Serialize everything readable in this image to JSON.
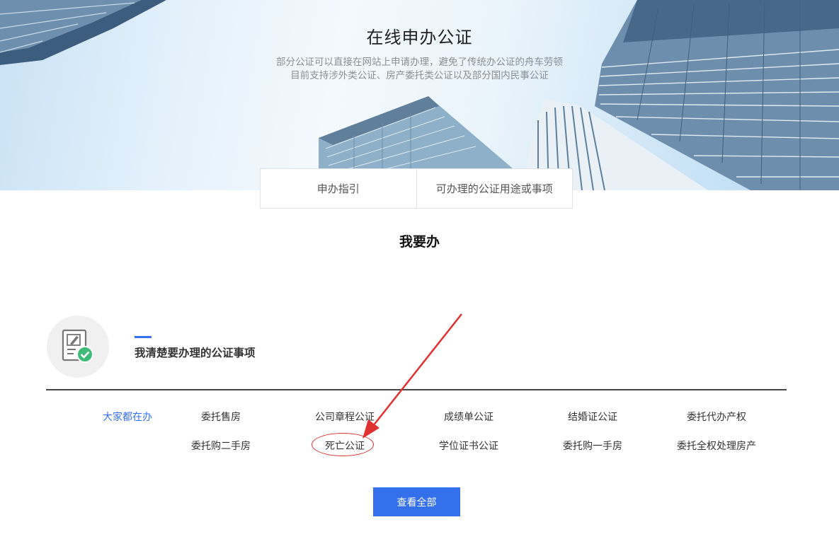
{
  "hero": {
    "title": "在线申办公证",
    "subtitle_line1": "部分公证可以直接在网站上申请办理，避免了传统办公证的舟车劳顿",
    "subtitle_line2": "目前支持涉外类公证、房产委托类公证以及部分国内民事公证"
  },
  "tabs": [
    "申办指引",
    "可办理的公证用途或事项"
  ],
  "section": {
    "title": "我要办",
    "category_title": "我清楚要办理的公证事项",
    "popular_label": "大家都在办",
    "row1": [
      "委托售房",
      "公司章程公证",
      "成绩单公证",
      "结婚证公证",
      "委托代办产权"
    ],
    "row2": [
      "委托购二手房",
      "死亡公证",
      "学位证书公证",
      "委托购一手房",
      "委托全权处理房产"
    ],
    "highlighted_item": "死亡公证",
    "view_all_label": "查看全部"
  },
  "colors": {
    "accent": "#3470ec",
    "annotation_red": "#e03131"
  },
  "icons": {
    "category": "document-check-icon"
  }
}
